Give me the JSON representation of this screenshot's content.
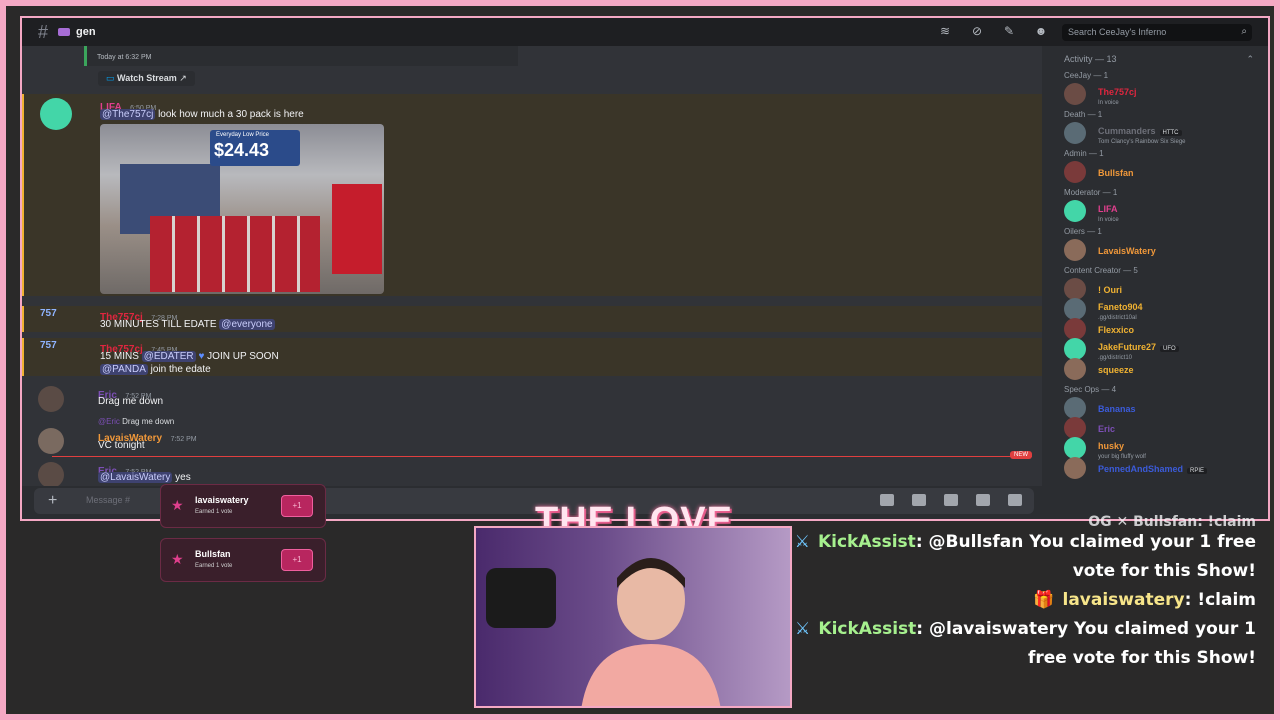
{
  "topbar": {
    "channel": "gen",
    "search_placeholder": "Search CeeJay's Inferno"
  },
  "chat": {
    "stream_time": "Today at 6:32 PM",
    "watch_stream": "Watch Stream",
    "messages": [
      {
        "author": "LIFA",
        "time": "6:50 PM",
        "mention": "@The757cj",
        "text": "look how much a 30 pack is here"
      },
      {
        "author": "The757cj",
        "time": "7:28 PM",
        "text": "30 MINUTES TILL EDATE",
        "mention": "@everyone"
      },
      {
        "author": "The757cj",
        "time": "7:45 PM",
        "text_a": "15 MINS",
        "mention_a": "@EDATER",
        "text_b": "JOIN UP SOON",
        "mention_b": "@PANDA",
        "text_c": "join the edate"
      },
      {
        "author": "Eric",
        "time": "7:52 PM",
        "text": "Drag me down"
      },
      {
        "reply_to": "@Eric",
        "reply_text": "Drag me down",
        "author": "LavaisWatery",
        "time": "7:52 PM",
        "text": "VC tonight"
      },
      {
        "author": "Eric",
        "time": "7:52 PM",
        "mention": "@LavaisWatery",
        "text": "yes"
      }
    ],
    "new_badge": "NEW",
    "image_price_label": "Everyday Low Price",
    "image_price": "$24.43"
  },
  "composer": {
    "placeholder": "Message #"
  },
  "members": {
    "activity": "Activity — 13",
    "groups": [
      {
        "title": "CeeJay — 1",
        "members": [
          {
            "name": "The757cj",
            "sub": "In voice",
            "color": "#e0263f"
          }
        ]
      },
      {
        "title": "Death — 1",
        "members": [
          {
            "name": "Cummanders",
            "tag": "HTTC",
            "sub": "Tom Clancy's Rainbow Six Siege",
            "color": "#6d6f78"
          }
        ]
      },
      {
        "title": "Admin — 1",
        "members": [
          {
            "name": "Bullsfan",
            "color": "#f0983a"
          }
        ]
      },
      {
        "title": "Moderator — 1",
        "members": [
          {
            "name": "LIFA",
            "sub": "In voice",
            "color": "#e03f8d"
          }
        ]
      },
      {
        "title": "Oilers — 1",
        "members": [
          {
            "name": "LavaisWatery",
            "color": "#f0983a"
          }
        ]
      },
      {
        "title": "Content Creator — 5",
        "members": [
          {
            "name": "! Ouri",
            "color": "#f0b232"
          },
          {
            "name": "Faneto904",
            "sub": ".gg/district10al",
            "color": "#f0b232"
          },
          {
            "name": "Flexxico",
            "color": "#f0b232"
          },
          {
            "name": "JakeFuture27",
            "tag": "UFO",
            "sub": ".gg/district10",
            "color": "#f0b232"
          },
          {
            "name": "squeeze",
            "color": "#f0b232"
          }
        ]
      },
      {
        "title": "Spec Ops — 4",
        "members": [
          {
            "name": "Bananas",
            "color": "#3b5bd9"
          },
          {
            "name": "Eric",
            "color": "#7c4fb5"
          },
          {
            "name": "husky",
            "sub": "your big fluffy wolf",
            "color": "#f0983a"
          },
          {
            "name": "PennedAndShamed",
            "tag": "RPIE",
            "color": "#3b5bd9"
          }
        ]
      }
    ]
  },
  "votes": [
    {
      "name": "lavaiswatery",
      "sub": "Earned 1 vote",
      "btn": "+1"
    },
    {
      "name": "Bullsfan",
      "sub": "Earned 1 vote",
      "btn": "+1"
    }
  ],
  "overlay": {
    "title": "THE LOVE SCALE"
  },
  "livechat": {
    "partial": "OG ✕ Bullsfan: !claim",
    "lines": [
      {
        "user": "KickAssist",
        "text": ": @Bullsfan You claimed your 1 free vote for this Show!"
      },
      {
        "user": "lavaiswatery",
        "text": ": !claim"
      },
      {
        "user": "KickAssist",
        "text": ": @lavaiswatery You claimed your 1 free vote for this Show!"
      }
    ]
  }
}
